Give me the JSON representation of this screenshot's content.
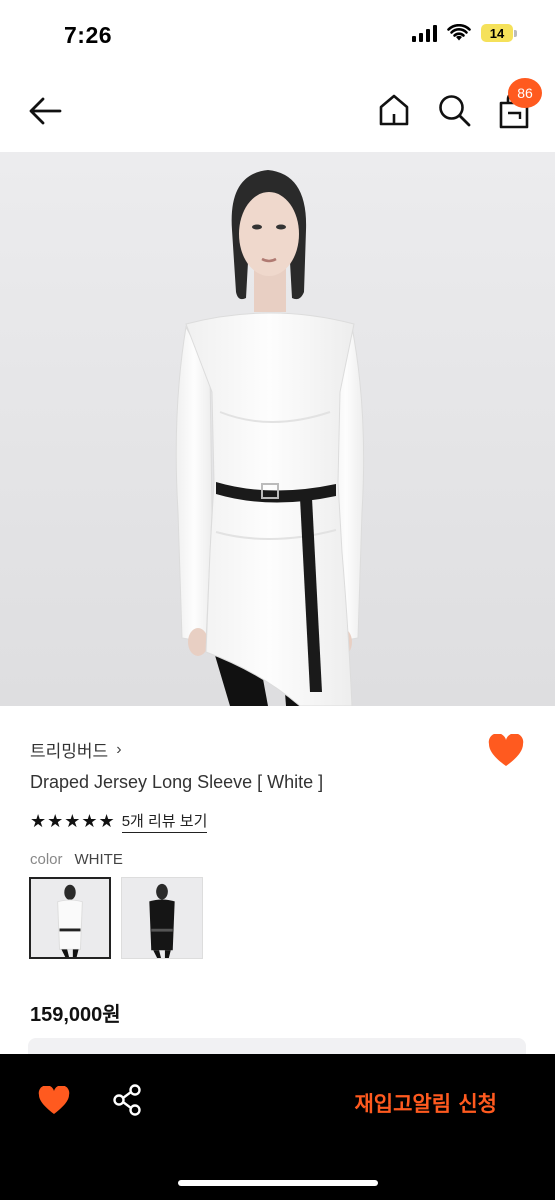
{
  "status_bar": {
    "time": "7:26",
    "battery": "14"
  },
  "nav": {
    "cart_count": "86"
  },
  "product": {
    "brand": "트리밍버드",
    "brand_chevron": "›",
    "name": "Draped Jersey Long Sleeve [ White ]",
    "stars": "★★★★★",
    "review_link": "5개 리뷰 보기",
    "color_label": "color",
    "color_value": "WHITE",
    "price": "159,000원"
  },
  "variants": [
    {
      "name": "white",
      "selected": true
    },
    {
      "name": "black",
      "selected": false
    }
  ],
  "bottom_bar": {
    "restock_label": "재입고알림 신청"
  },
  "colors": {
    "accent": "#ff5a1f",
    "bottom_bg": "#000000",
    "battery": "#f5e15a"
  },
  "icons": [
    "back-arrow-icon",
    "home-icon",
    "search-icon",
    "cart-icon",
    "heart-icon",
    "share-icon"
  ]
}
